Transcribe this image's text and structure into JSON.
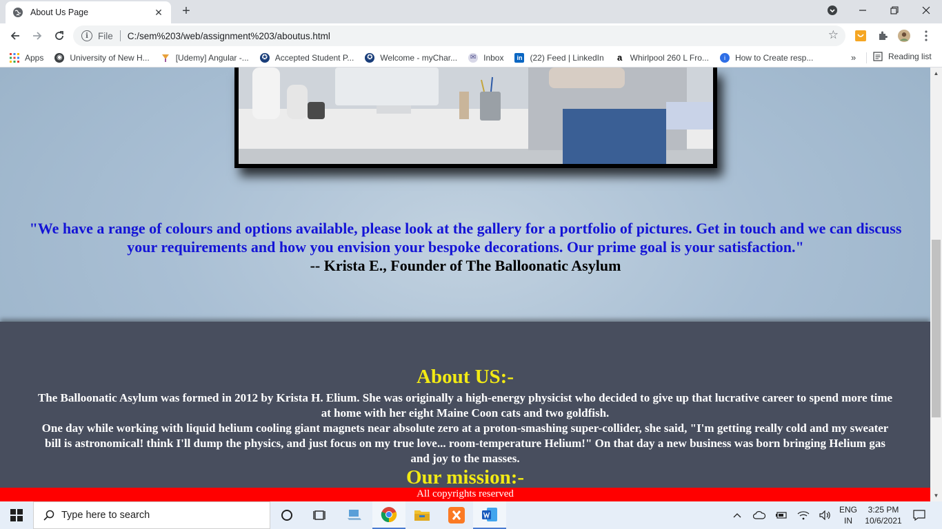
{
  "browser": {
    "tab": {
      "title": "About Us Page"
    },
    "address": {
      "scheme": "File",
      "url": "C:/sem%203/web/assignment%203/aboutus.html"
    },
    "bookmarks": [
      {
        "label": "Apps",
        "icon": "apps-grid-icon"
      },
      {
        "label": "University of New H...",
        "icon": "globe-icon"
      },
      {
        "label": "[Udemy] Angular -...",
        "icon": "udemy-icon"
      },
      {
        "label": "Accepted Student P...",
        "icon": "university-icon"
      },
      {
        "label": "Welcome - myChar...",
        "icon": "university-icon"
      },
      {
        "label": "Inbox",
        "icon": "mail-icon"
      },
      {
        "label": "(22) Feed | LinkedIn",
        "icon": "linkedin-icon"
      },
      {
        "label": "Whirlpool 260 L Fro...",
        "icon": "amazon-icon"
      },
      {
        "label": "How to Create resp...",
        "icon": "info-icon"
      }
    ],
    "bookmarks_more": "»",
    "reading_list": "Reading list"
  },
  "page": {
    "quote": "\"We have a range of colours and options available, please look at the gallery for a portfolio of pictures. Get in touch and we can discuss your requirements and how you envision your bespoke decorations. Our prime goal is your satisfaction.\"",
    "quote_author": "-- Krista E., Founder of The Balloonatic Asylum",
    "about_heading": "About US:-",
    "about_paragraph_1": "The Balloonatic Asylum was formed in 2012 by Krista H. Elium. She was originally a high-energy physicist who decided to give up that lucrative career to spend more time at home with her eight Maine Coon cats and two goldfish.",
    "about_paragraph_2": "One day while working with liquid helium cooling giant magnets near absolute zero at a proton-smashing super-collider, she said, \"I'm getting really cold and my sweater bill is astronomical! think I'll dump the physics, and just focus on my true love... room-temperature Helium!\" On that day a new business was born bringing Helium gas and joy to the masses.",
    "mission_heading": "Our mission:-",
    "footer": "All copyrights reserved",
    "colors": {
      "quote": "#1414d6",
      "heading": "#f2ea14",
      "about_bg": "#484e5e",
      "footer_bg": "#ff0000"
    }
  },
  "taskbar": {
    "search_placeholder": "Type here to search",
    "language": "ENG",
    "region": "IN",
    "time": "3:25 PM",
    "date": "10/6/2021"
  }
}
